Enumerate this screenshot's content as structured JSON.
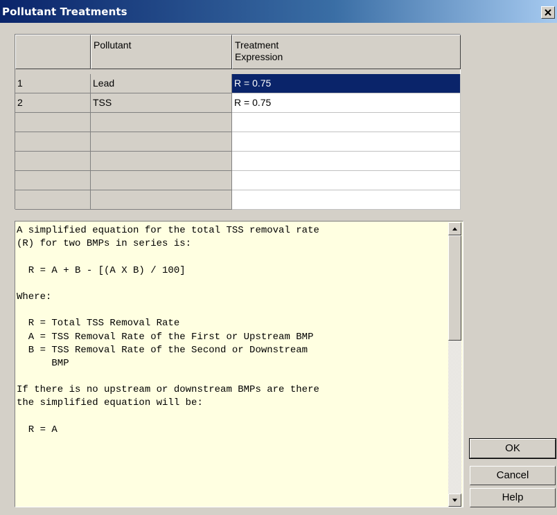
{
  "window": {
    "title": "Pollutant Treatments",
    "close_icon": "close-icon"
  },
  "grid": {
    "columns": [
      "",
      "Pollutant",
      "Treatment\nExpression"
    ],
    "rows": [
      {
        "num": "1",
        "pollutant": "Lead",
        "expression": "R = 0.75",
        "selected": true
      },
      {
        "num": "2",
        "pollutant": "TSS",
        "expression": "R = 0.75",
        "selected": false
      },
      {
        "num": "",
        "pollutant": "",
        "expression": "",
        "selected": false
      },
      {
        "num": "",
        "pollutant": "",
        "expression": "",
        "selected": false
      },
      {
        "num": "",
        "pollutant": "",
        "expression": "",
        "selected": false
      },
      {
        "num": "",
        "pollutant": "",
        "expression": "",
        "selected": false
      },
      {
        "num": "",
        "pollutant": "",
        "expression": "",
        "selected": false
      }
    ]
  },
  "memo": {
    "lines": [
      "A simplified equation for the total TSS removal rate",
      "(R) for two BMPs in series is:",
      "",
      "  R = A + B - [(A X B) / 100]",
      "",
      "Where:",
      "",
      "  R = Total TSS Removal Rate",
      "  A = TSS Removal Rate of the First or Upstream BMP",
      "  B = TSS Removal Rate of the Second or Downstream",
      "      BMP",
      "",
      "If there is no upstream or downstream BMPs are there",
      "the simplified equation will be:",
      "",
      "  R = A"
    ]
  },
  "buttons": {
    "ok": "OK",
    "cancel": "Cancel",
    "help": "Help"
  },
  "colors": {
    "title_bar": "#0a246a",
    "selection": "#0a246a",
    "memo_background": "#ffffe1",
    "face": "#d4d0c8"
  }
}
